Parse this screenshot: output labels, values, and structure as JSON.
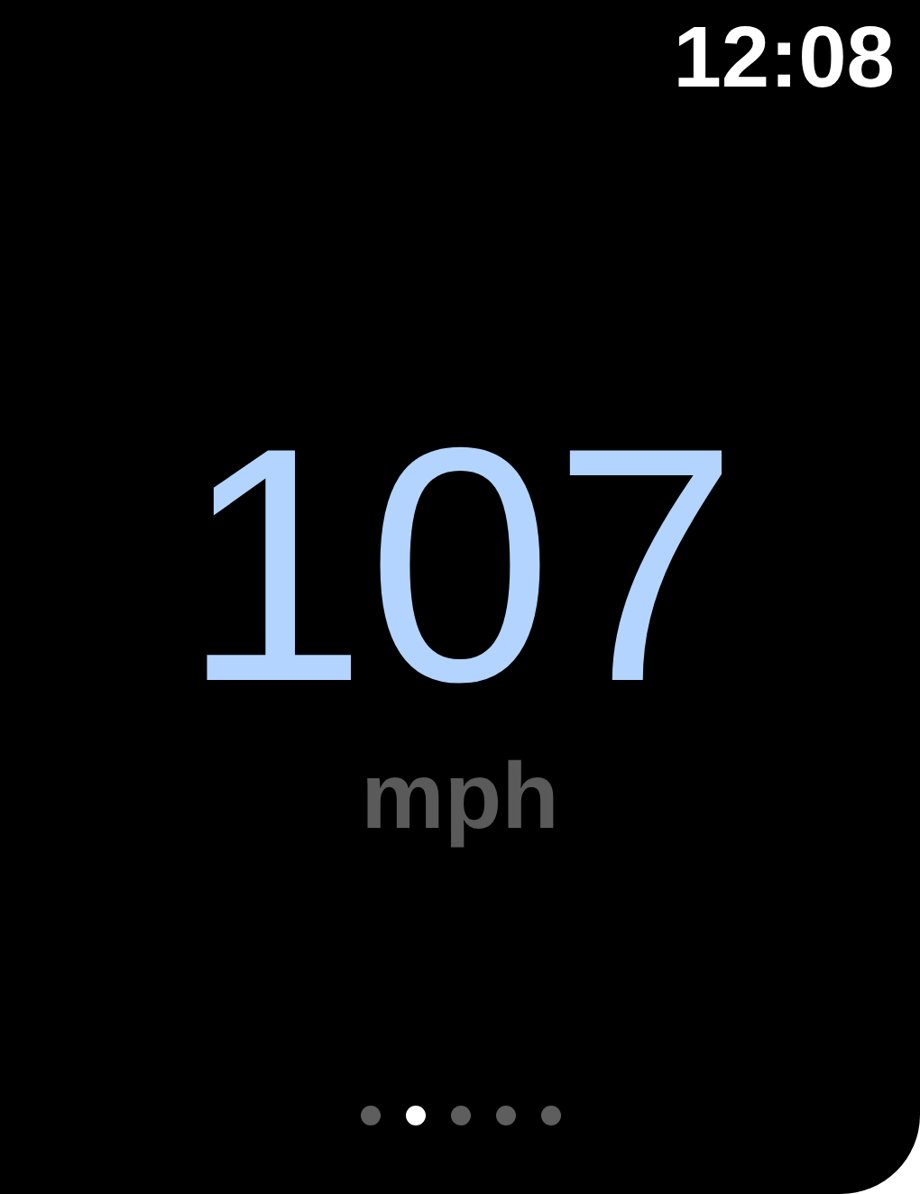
{
  "status_bar": {
    "time": "12:08"
  },
  "speed": {
    "value": "107",
    "unit": "mph"
  },
  "page_dots": [
    {
      "selected": false
    },
    {
      "selected": true
    },
    {
      "selected": false
    },
    {
      "selected": false
    },
    {
      "selected": false
    }
  ]
}
